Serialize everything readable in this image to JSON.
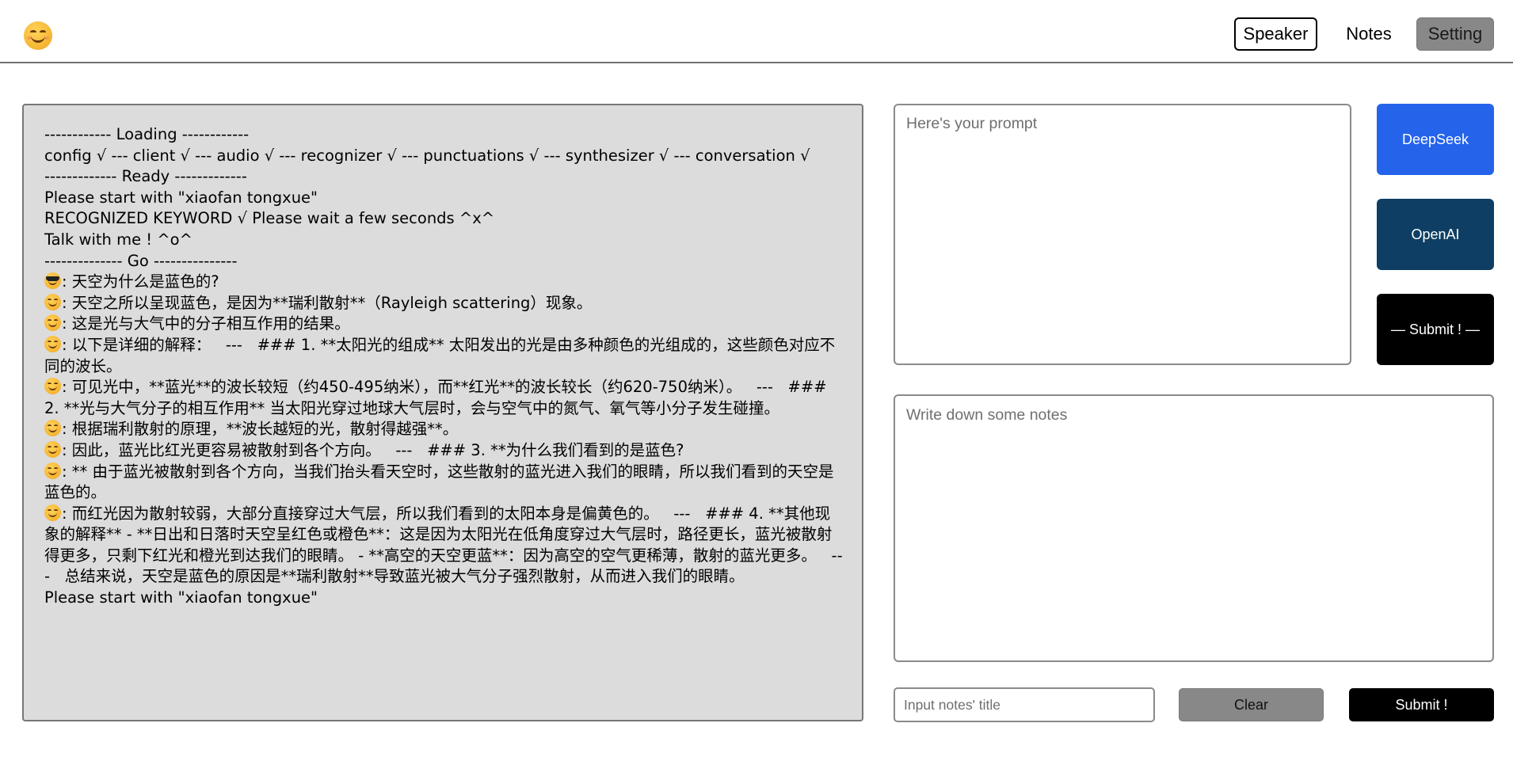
{
  "header": {
    "logo_icon": "smiling-face-icon",
    "nav": {
      "speaker": "Speaker",
      "notes": "Notes",
      "setting": "Setting"
    }
  },
  "log": {
    "lines": [
      {
        "icon": null,
        "text": "------------ Loading ------------"
      },
      {
        "icon": null,
        "text": "config √ --- client √ --- audio √ --- recognizer √ --- punctuations √ --- synthesizer √ --- conversation √"
      },
      {
        "icon": null,
        "text": "------------- Ready -------------"
      },
      {
        "icon": null,
        "text": "Please start with \"xiaofan tongxue\""
      },
      {
        "icon": null,
        "text": "RECOGNIZED KEYWORD √ Please wait a few seconds ^x^"
      },
      {
        "icon": null,
        "text": "Talk with me ! ^o^"
      },
      {
        "icon": null,
        "text": "-------------- Go ---------------"
      },
      {
        "icon": "cool",
        "text": ": 天空为什么是蓝色的?"
      },
      {
        "icon": "smile",
        "text": ": 天空之所以呈现蓝色，是因为**瑞利散射**（Rayleigh scattering）现象。"
      },
      {
        "icon": "smile",
        "text": ": 这是光与大气中的分子相互作用的结果。"
      },
      {
        "icon": "smile",
        "text": ": 以下是详细的解释：   ---   ### 1. **太阳光的组成** 太阳发出的光是由多种颜色的光组成的，这些颜色对应不同的波长。"
      },
      {
        "icon": "smile",
        "text": ": 可见光中，**蓝光**的波长较短（约450-495纳米），而**红光**的波长较长（约620-750纳米）。   ---   ### 2. **光与大气分子的相互作用** 当太阳光穿过地球大气层时，会与空气中的氮气、氧气等小分子发生碰撞。"
      },
      {
        "icon": "smile",
        "text": ": 根据瑞利散射的原理，**波长越短的光，散射得越强**。"
      },
      {
        "icon": "smile",
        "text": ": 因此，蓝光比红光更容易被散射到各个方向。   ---   ### 3. **为什么我们看到的是蓝色?"
      },
      {
        "icon": "smile",
        "text": ": ** 由于蓝光被散射到各个方向，当我们抬头看天空时，这些散射的蓝光进入我们的眼睛，所以我们看到的天空是蓝色的。"
      },
      {
        "icon": "smile",
        "text": ": 而红光因为散射较弱，大部分直接穿过大气层，所以我们看到的太阳本身是偏黄色的。   ---   ### 4. **其他现象的解释** - **日出和日落时天空呈红色或橙色**：这是因为太阳光在低角度穿过大气层时，路径更长，蓝光被散射得更多，只剩下红光和橙光到达我们的眼睛。 - **高空的天空更蓝**：因为高空的空气更稀薄，散射的蓝光更多。   ---   总结来说，天空是蓝色的原因是**瑞利散射**导致蓝光被大气分子强烈散射，从而进入我们的眼睛。"
      },
      {
        "icon": null,
        "text": "Please start with \"xiaofan tongxue\""
      }
    ]
  },
  "prompt": {
    "placeholder": "Here's your prompt",
    "value": ""
  },
  "model_buttons": {
    "deepseek": "DeepSeek",
    "openai": "OpenAI",
    "submit": "— Submit ! —"
  },
  "notes": {
    "placeholder": "Write down some notes",
    "title_placeholder": "Input notes' title",
    "clear": "Clear",
    "submit": "Submit !"
  },
  "colors": {
    "deepseek": "#2563eb",
    "openai": "#0e3e63",
    "submit": "#000000",
    "clear": "#888888",
    "log_background": "#dcdcdc"
  }
}
